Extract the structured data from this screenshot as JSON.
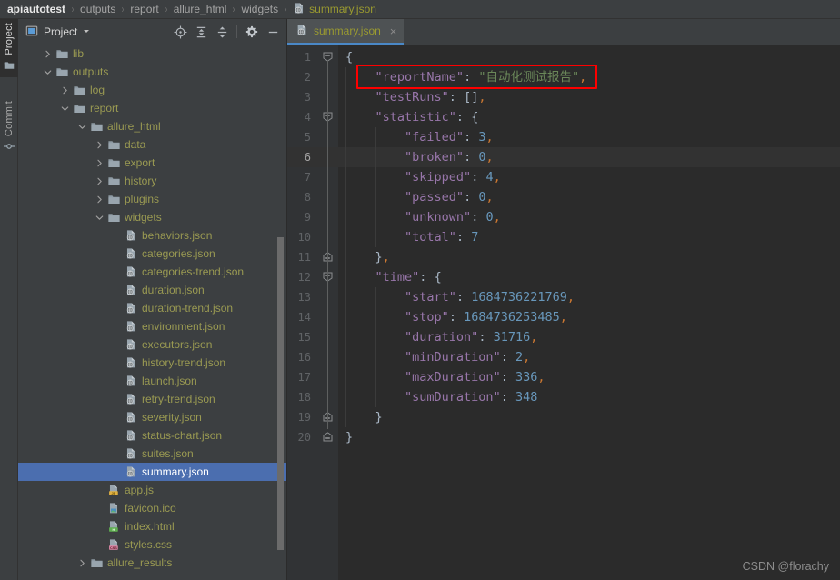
{
  "window": {
    "watermark": "CSDN @florachy"
  },
  "breadcrumb": {
    "separator": "›",
    "items": [
      {
        "label": "apiautotest",
        "icon": "",
        "type": "project"
      },
      {
        "label": "outputs",
        "icon": "",
        "type": "folder"
      },
      {
        "label": "report",
        "icon": "",
        "type": "folder"
      },
      {
        "label": "allure_html",
        "icon": "",
        "type": "folder"
      },
      {
        "label": "widgets",
        "icon": "",
        "type": "folder"
      },
      {
        "label": "summary.json",
        "icon": "json-file-icon",
        "type": "file"
      }
    ]
  },
  "toolstrip": {
    "tabs": [
      {
        "label": "Project",
        "icon": "folder-icon",
        "active": true
      },
      {
        "label": "Commit",
        "icon": "commit-icon",
        "active": false
      }
    ]
  },
  "project_panel": {
    "title": "Project",
    "title_icon": "project-view-icon",
    "dropdown_icon": "chevron-down-icon",
    "tools": [
      {
        "name": "scroll-from-source-icon",
        "tooltip": "Select Opened File"
      },
      {
        "name": "expand-all-icon",
        "tooltip": "Expand All"
      },
      {
        "name": "collapse-all-icon",
        "tooltip": "Collapse All"
      },
      {
        "name": "settings-gear-icon",
        "tooltip": "Options"
      },
      {
        "name": "hide-panel-icon",
        "tooltip": "Hide"
      }
    ],
    "tree": [
      {
        "label": "lib",
        "depth": 1,
        "type": "folder",
        "state": "collapsed",
        "selected": false
      },
      {
        "label": "outputs",
        "depth": 1,
        "type": "folder",
        "state": "expanded",
        "selected": false
      },
      {
        "label": "log",
        "depth": 2,
        "type": "folder",
        "state": "collapsed",
        "selected": false
      },
      {
        "label": "report",
        "depth": 2,
        "type": "folder",
        "state": "expanded",
        "selected": false
      },
      {
        "label": "allure_html",
        "depth": 3,
        "type": "folder",
        "state": "expanded",
        "selected": false
      },
      {
        "label": "data",
        "depth": 4,
        "type": "folder",
        "state": "collapsed",
        "selected": false
      },
      {
        "label": "export",
        "depth": 4,
        "type": "folder",
        "state": "collapsed",
        "selected": false
      },
      {
        "label": "history",
        "depth": 4,
        "type": "folder",
        "state": "collapsed",
        "selected": false
      },
      {
        "label": "plugins",
        "depth": 4,
        "type": "folder",
        "state": "collapsed",
        "selected": false
      },
      {
        "label": "widgets",
        "depth": 4,
        "type": "folder",
        "state": "expanded",
        "selected": false
      },
      {
        "label": "behaviors.json",
        "depth": 5,
        "type": "json",
        "state": "leaf",
        "selected": false
      },
      {
        "label": "categories.json",
        "depth": 5,
        "type": "json",
        "state": "leaf",
        "selected": false
      },
      {
        "label": "categories-trend.json",
        "depth": 5,
        "type": "json",
        "state": "leaf",
        "selected": false
      },
      {
        "label": "duration.json",
        "depth": 5,
        "type": "json",
        "state": "leaf",
        "selected": false
      },
      {
        "label": "duration-trend.json",
        "depth": 5,
        "type": "json",
        "state": "leaf",
        "selected": false
      },
      {
        "label": "environment.json",
        "depth": 5,
        "type": "json",
        "state": "leaf",
        "selected": false
      },
      {
        "label": "executors.json",
        "depth": 5,
        "type": "json",
        "state": "leaf",
        "selected": false
      },
      {
        "label": "history-trend.json",
        "depth": 5,
        "type": "json",
        "state": "leaf",
        "selected": false
      },
      {
        "label": "launch.json",
        "depth": 5,
        "type": "json",
        "state": "leaf",
        "selected": false
      },
      {
        "label": "retry-trend.json",
        "depth": 5,
        "type": "json",
        "state": "leaf",
        "selected": false
      },
      {
        "label": "severity.json",
        "depth": 5,
        "type": "json",
        "state": "leaf",
        "selected": false
      },
      {
        "label": "status-chart.json",
        "depth": 5,
        "type": "json",
        "state": "leaf",
        "selected": false
      },
      {
        "label": "suites.json",
        "depth": 5,
        "type": "json",
        "state": "leaf",
        "selected": false
      },
      {
        "label": "summary.json",
        "depth": 5,
        "type": "json",
        "state": "leaf",
        "selected": true
      },
      {
        "label": "app.js",
        "depth": 4,
        "type": "js",
        "state": "leaf",
        "selected": false
      },
      {
        "label": "favicon.ico",
        "depth": 4,
        "type": "ico",
        "state": "leaf",
        "selected": false
      },
      {
        "label": "index.html",
        "depth": 4,
        "type": "html",
        "state": "leaf",
        "selected": false
      },
      {
        "label": "styles.css",
        "depth": 4,
        "type": "css",
        "state": "leaf",
        "selected": false
      },
      {
        "label": "allure_results",
        "depth": 3,
        "type": "folder",
        "state": "collapsed",
        "selected": false
      }
    ]
  },
  "editor": {
    "tabs": [
      {
        "label": "summary.json",
        "icon": "json-file-icon",
        "active": true,
        "close_icon": "close-icon",
        "close_label": "×"
      }
    ],
    "current_line": 6,
    "lines": [
      {
        "num": 1,
        "fold": "start",
        "tokens": [
          {
            "t": "{",
            "c": "p"
          }
        ]
      },
      {
        "num": 2,
        "fold": "mid",
        "tokens": [
          {
            "t": "    ",
            "c": "p"
          },
          {
            "t": "\"reportName\"",
            "c": "k"
          },
          {
            "t": ": ",
            "c": "p"
          },
          {
            "t": "\"自动化测试报告\"",
            "c": "s"
          },
          {
            "t": ",",
            "c": "cm"
          }
        ]
      },
      {
        "num": 3,
        "fold": "mid",
        "tokens": [
          {
            "t": "    ",
            "c": "p"
          },
          {
            "t": "\"testRuns\"",
            "c": "k"
          },
          {
            "t": ": ",
            "c": "p"
          },
          {
            "t": "[]",
            "c": "p"
          },
          {
            "t": ",",
            "c": "cm"
          }
        ]
      },
      {
        "num": 4,
        "fold": "start",
        "tokens": [
          {
            "t": "    ",
            "c": "p"
          },
          {
            "t": "\"statistic\"",
            "c": "k"
          },
          {
            "t": ": ",
            "c": "p"
          },
          {
            "t": "{",
            "c": "p"
          }
        ]
      },
      {
        "num": 5,
        "fold": "mid",
        "tokens": [
          {
            "t": "        ",
            "c": "p"
          },
          {
            "t": "\"failed\"",
            "c": "k"
          },
          {
            "t": ": ",
            "c": "p"
          },
          {
            "t": "3",
            "c": "n"
          },
          {
            "t": ",",
            "c": "cm"
          }
        ]
      },
      {
        "num": 6,
        "fold": "mid",
        "tokens": [
          {
            "t": "        ",
            "c": "p"
          },
          {
            "t": "\"broken\"",
            "c": "k"
          },
          {
            "t": ": ",
            "c": "p"
          },
          {
            "t": "0",
            "c": "n"
          },
          {
            "t": ",",
            "c": "cm"
          }
        ]
      },
      {
        "num": 7,
        "fold": "mid",
        "tokens": [
          {
            "t": "        ",
            "c": "p"
          },
          {
            "t": "\"skipped\"",
            "c": "k"
          },
          {
            "t": ": ",
            "c": "p"
          },
          {
            "t": "4",
            "c": "n"
          },
          {
            "t": ",",
            "c": "cm"
          }
        ]
      },
      {
        "num": 8,
        "fold": "mid",
        "tokens": [
          {
            "t": "        ",
            "c": "p"
          },
          {
            "t": "\"passed\"",
            "c": "k"
          },
          {
            "t": ": ",
            "c": "p"
          },
          {
            "t": "0",
            "c": "n"
          },
          {
            "t": ",",
            "c": "cm"
          }
        ]
      },
      {
        "num": 9,
        "fold": "mid",
        "tokens": [
          {
            "t": "        ",
            "c": "p"
          },
          {
            "t": "\"unknown\"",
            "c": "k"
          },
          {
            "t": ": ",
            "c": "p"
          },
          {
            "t": "0",
            "c": "n"
          },
          {
            "t": ",",
            "c": "cm"
          }
        ]
      },
      {
        "num": 10,
        "fold": "mid",
        "tokens": [
          {
            "t": "        ",
            "c": "p"
          },
          {
            "t": "\"total\"",
            "c": "k"
          },
          {
            "t": ": ",
            "c": "p"
          },
          {
            "t": "7",
            "c": "n"
          }
        ]
      },
      {
        "num": 11,
        "fold": "end",
        "tokens": [
          {
            "t": "    ",
            "c": "p"
          },
          {
            "t": "}",
            "c": "p"
          },
          {
            "t": ",",
            "c": "cm"
          }
        ]
      },
      {
        "num": 12,
        "fold": "start",
        "tokens": [
          {
            "t": "    ",
            "c": "p"
          },
          {
            "t": "\"time\"",
            "c": "k"
          },
          {
            "t": ": ",
            "c": "p"
          },
          {
            "t": "{",
            "c": "p"
          }
        ]
      },
      {
        "num": 13,
        "fold": "mid",
        "tokens": [
          {
            "t": "        ",
            "c": "p"
          },
          {
            "t": "\"start\"",
            "c": "k"
          },
          {
            "t": ": ",
            "c": "p"
          },
          {
            "t": "1684736221769",
            "c": "n"
          },
          {
            "t": ",",
            "c": "cm"
          }
        ]
      },
      {
        "num": 14,
        "fold": "mid",
        "tokens": [
          {
            "t": "        ",
            "c": "p"
          },
          {
            "t": "\"stop\"",
            "c": "k"
          },
          {
            "t": ": ",
            "c": "p"
          },
          {
            "t": "1684736253485",
            "c": "n"
          },
          {
            "t": ",",
            "c": "cm"
          }
        ]
      },
      {
        "num": 15,
        "fold": "mid",
        "tokens": [
          {
            "t": "        ",
            "c": "p"
          },
          {
            "t": "\"duration\"",
            "c": "k"
          },
          {
            "t": ": ",
            "c": "p"
          },
          {
            "t": "31716",
            "c": "n"
          },
          {
            "t": ",",
            "c": "cm"
          }
        ]
      },
      {
        "num": 16,
        "fold": "mid",
        "tokens": [
          {
            "t": "        ",
            "c": "p"
          },
          {
            "t": "\"minDuration\"",
            "c": "k"
          },
          {
            "t": ": ",
            "c": "p"
          },
          {
            "t": "2",
            "c": "n"
          },
          {
            "t": ",",
            "c": "cm"
          }
        ]
      },
      {
        "num": 17,
        "fold": "mid",
        "tokens": [
          {
            "t": "        ",
            "c": "p"
          },
          {
            "t": "\"maxDuration\"",
            "c": "k"
          },
          {
            "t": ": ",
            "c": "p"
          },
          {
            "t": "336",
            "c": "n"
          },
          {
            "t": ",",
            "c": "cm"
          }
        ]
      },
      {
        "num": 18,
        "fold": "mid",
        "tokens": [
          {
            "t": "        ",
            "c": "p"
          },
          {
            "t": "\"sumDuration\"",
            "c": "k"
          },
          {
            "t": ": ",
            "c": "p"
          },
          {
            "t": "348",
            "c": "n"
          }
        ]
      },
      {
        "num": 19,
        "fold": "end",
        "tokens": [
          {
            "t": "    ",
            "c": "p"
          },
          {
            "t": "}",
            "c": "p"
          }
        ]
      },
      {
        "num": 20,
        "fold": "end",
        "tokens": [
          {
            "t": "}",
            "c": "p"
          }
        ]
      }
    ],
    "annotation": {
      "type": "red-rectangle",
      "color": "#fe0000",
      "target_line": 2
    }
  },
  "colors": {
    "panel_bg": "#3c3f41",
    "editor_bg": "#2b2b2b",
    "gutter_bg": "#313335",
    "selection_blue": "#4b6eaf",
    "folder_label": "#9a9a52",
    "key_purple": "#9876aa",
    "string_green": "#6a8759",
    "number_blue": "#6897bb",
    "annotation_red": "#fe0000"
  }
}
